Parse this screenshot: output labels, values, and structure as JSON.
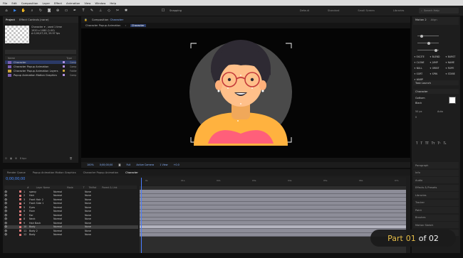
{
  "menubar": [
    "File",
    "Edit",
    "Composition",
    "Layer",
    "Effect",
    "Animation",
    "View",
    "Window",
    "Help"
  ],
  "toolbar": {
    "snapping": "Snapping",
    "workspaces": [
      "Default",
      "Standard",
      "Small Screen",
      "Libraries"
    ],
    "search_placeholder": "Search Help"
  },
  "project": {
    "tabs": [
      "Project",
      "Effect Controls (none)"
    ],
    "meta": [
      "Character ▾ , used 1 time",
      "1920 x 1080 (1.00)",
      "Δ 0;00;07;03, 29.97 fps"
    ],
    "columns": [
      "Name",
      "Type"
    ],
    "items": [
      {
        "name": "Character",
        "type": "Comp",
        "color": "#b08fe0",
        "folder": false,
        "selected": true
      },
      {
        "name": "Character Popup Animation",
        "type": "Comp",
        "color": "#b08fe0",
        "folder": false
      },
      {
        "name": "Character Popup Animation Layers",
        "type": "Folder",
        "color": "#c9a23a",
        "folder": true
      },
      {
        "name": "Popup Animation Motion Graphics",
        "type": "Comp",
        "color": "#b08fe0",
        "folder": false
      }
    ],
    "bpc": "8 bpc"
  },
  "comp": {
    "tab": "Composition",
    "tab_name": "Character",
    "breadcrumbs": [
      "Character Popup Animation",
      "Character"
    ],
    "footer": [
      "100%",
      "0;00;00;00",
      "Full",
      "Active Camera",
      "1 View",
      "+0.0"
    ]
  },
  "right": {
    "align": {
      "title": "Motion 2",
      "tab2": "Align",
      "tab3": "Info"
    },
    "buttons": [
      "EXCITE",
      "BLEND",
      "BURST",
      "CLONE",
      "JUMP",
      "NAME",
      "NULL",
      "ORBIT",
      "ROPE",
      "SORT",
      "SPIN",
      "STARE",
      "WARP"
    ],
    "task": "Task Launch",
    "character": {
      "title": "Character",
      "font": "Gotham",
      "style": "Black",
      "size": "50 px",
      "leading": "Auto",
      "tracking": "0"
    },
    "panels": [
      "Paragraph",
      "Info",
      "Audio",
      "Effects & Presets",
      "Libraries",
      "Tracker",
      "Paint",
      "Brushes",
      "Motion Sketch",
      "Smoother"
    ]
  },
  "timeline": {
    "tabs": [
      "Render Queue",
      "Popup Animation Motion Graphics",
      "Character Popup Animation",
      "Character"
    ],
    "time": "0;00;00;00",
    "columns": [
      "#",
      "Layer Name",
      "Mode",
      "T",
      "TrkMat",
      "Parent & Link"
    ],
    "layers": [
      {
        "n": "1",
        "name": "spexy",
        "mode": "Normal",
        "parent": "None"
      },
      {
        "n": "2",
        "name": "Hair",
        "mode": "Normal",
        "parent": "None"
      },
      {
        "n": "3",
        "name": "Front Hair 2",
        "mode": "Normal",
        "parent": "None"
      },
      {
        "n": "4",
        "name": "Front Side 1",
        "mode": "Normal",
        "parent": "None"
      },
      {
        "n": "5",
        "name": "Eyes",
        "mode": "Normal",
        "parent": "None"
      },
      {
        "n": "6",
        "name": "Face",
        "mode": "Normal",
        "parent": "None"
      },
      {
        "n": "7",
        "name": "Ear",
        "mode": "Normal",
        "parent": "None"
      },
      {
        "n": "8",
        "name": "Neck",
        "mode": "Normal",
        "parent": "None"
      },
      {
        "n": "9",
        "name": "Hair Back",
        "mode": "Normal",
        "parent": "None"
      },
      {
        "n": "10",
        "name": "Body",
        "mode": "Normal",
        "parent": "None",
        "selected": true
      },
      {
        "n": "11",
        "name": "Body 2",
        "mode": "Normal",
        "parent": "None"
      },
      {
        "n": "12",
        "name": "Body",
        "mode": "Normal",
        "parent": "None"
      }
    ],
    "ruler": [
      "0s",
      "01s",
      "02s",
      "03s",
      "04s",
      "05s",
      "06s",
      "07s"
    ]
  },
  "overlay": {
    "part": "Part",
    "num": "01",
    "of": "of 02"
  }
}
